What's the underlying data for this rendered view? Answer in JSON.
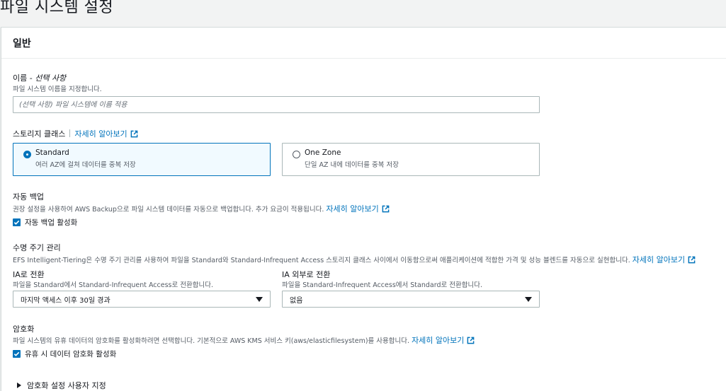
{
  "page_title": "파일 시스템 설정",
  "panel": {
    "title": "일반"
  },
  "name": {
    "label": "이름 - ",
    "label_optional": "선택 사항",
    "description": "파일 시스템 이름을 지정합니다.",
    "placeholder": "(선택 사항) 파일 시스템에 이름 적용",
    "value": ""
  },
  "storage_class": {
    "label": "스토리지 클래스",
    "learn_more": "자세히 알아보기",
    "options": [
      {
        "title": "Standard",
        "description": "여러 AZ에 걸쳐 데이터를 중복 저장",
        "selected": true
      },
      {
        "title": "One Zone",
        "description": "단일 AZ 내에 데이터를 중복 저장",
        "selected": false
      }
    ]
  },
  "backup": {
    "label": "자동 백업",
    "description": "권장 설정을 사용하여 AWS Backup으로 파일 시스템 데이터를 자동으로 백업합니다. 추가 요금이 적용됩니다.",
    "learn_more": "자세히 알아보기",
    "checkbox_label": "자동 백업 활성화",
    "checked": true
  },
  "lifecycle": {
    "label": "수명 주기 관리",
    "description": "EFS Intelligent-Tiering은 수명 주기 관리를 사용하여 파일을 Standard와 Standard-Infrequent Access 스토리지 클래스 사이에서 이동함으로써 애플리케이션에 적합한 가격 및 성능 블렌드를 자동으로 실현합니다.",
    "learn_more": "자세히 알아보기",
    "to_ia": {
      "label": "IA로 전환",
      "description": "파일을 Standard에서 Standard-Infrequent Access로 전환합니다.",
      "selected": "마지막 액세스 이후 30일 경과"
    },
    "out_of_ia": {
      "label": "IA 외부로 전환",
      "description": "파일을 Standard-Infrequent Access에서 Standard로 전환합니다.",
      "selected": "없음"
    }
  },
  "encryption": {
    "label": "암호화",
    "description": "파일 시스템의 유휴 데이터의 암호화를 활성화하려면 선택합니다. 기본적으로 AWS KMS 서비스 키(aws/elasticfilesystem)를 사용합니다.",
    "learn_more": "자세히 알아보기",
    "checkbox_label": "유휴 시 데이터 암호화 활성화",
    "checked": true,
    "expander_label": "암호화 설정 사용자 지정"
  },
  "colors": {
    "link": "#0073bb",
    "selected_border": "#0073bb",
    "selected_bg": "#f1faff"
  }
}
